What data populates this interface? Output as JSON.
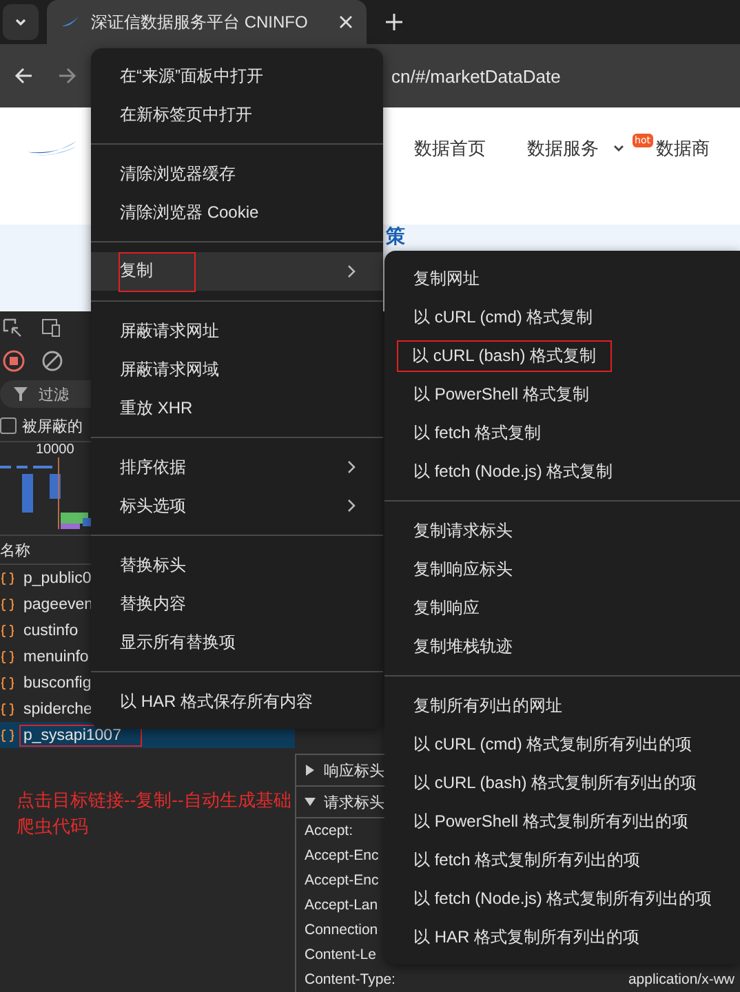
{
  "browser": {
    "tabs": [
      {
        "title": "深证信数据服务平台 CNINFO",
        "selected": true
      }
    ],
    "address": "cn/#/marketDataDate"
  },
  "site": {
    "nav": [
      {
        "label": "数据首页",
        "dropdown": false,
        "hot": false
      },
      {
        "label": "数据服务",
        "dropdown": true,
        "hot": false
      },
      {
        "label": "数据商",
        "dropdown": false,
        "hot": true
      }
    ],
    "hot_badge": "hot",
    "banner_text": "策"
  },
  "devtools": {
    "filter_placeholder": "过滤",
    "blocked_checkbox": {
      "label": "被屏蔽的",
      "checked": false
    },
    "timeline_label": "10000",
    "column": "名称",
    "requests": [
      {
        "name": "p_public0",
        "selected": false,
        "annotated": false
      },
      {
        "name": "pageeven",
        "selected": false,
        "annotated": false
      },
      {
        "name": "custinfo",
        "selected": false,
        "annotated": false
      },
      {
        "name": "menuinfo",
        "selected": false,
        "annotated": false
      },
      {
        "name": "busconfig",
        "selected": false,
        "annotated": false
      },
      {
        "name": "spiderche",
        "selected": false,
        "annotated": false
      },
      {
        "name": "p_sysapi1007",
        "selected": true,
        "annotated": true
      }
    ],
    "detail_sections": [
      {
        "label": "响应标头",
        "expanded": false
      },
      {
        "label": "请求标头",
        "expanded": true
      }
    ],
    "headers": [
      {
        "name": "Accept:"
      },
      {
        "name": "Accept-Enc"
      },
      {
        "name": "Accept-Enc"
      },
      {
        "name": "Accept-Lan"
      },
      {
        "name": "Connection"
      },
      {
        "name": "Content-Le"
      },
      {
        "name": "Content-Type:",
        "value": "application/x-ww"
      }
    ]
  },
  "annotation": "点击目标链接--复制--自动生成基础爬虫代码",
  "context_menu": [
    [
      {
        "label": "在“来源”面板中打开",
        "submenu": false,
        "highlighted": false,
        "annotated": false
      },
      {
        "label": "在新标签页中打开",
        "submenu": false,
        "highlighted": false,
        "annotated": false
      }
    ],
    [
      {
        "label": "清除浏览器缓存",
        "submenu": false,
        "highlighted": false,
        "annotated": false
      },
      {
        "label": "清除浏览器 Cookie",
        "submenu": false,
        "highlighted": false,
        "annotated": false
      }
    ],
    [
      {
        "label": "复制",
        "submenu": true,
        "highlighted": true,
        "annotated": true
      }
    ],
    [
      {
        "label": "屏蔽请求网址",
        "submenu": false,
        "highlighted": false,
        "annotated": false
      },
      {
        "label": "屏蔽请求网域",
        "submenu": false,
        "highlighted": false,
        "annotated": false
      },
      {
        "label": "重放 XHR",
        "submenu": false,
        "highlighted": false,
        "annotated": false
      }
    ],
    [
      {
        "label": "排序依据",
        "submenu": true,
        "highlighted": false,
        "annotated": false
      },
      {
        "label": "标头选项",
        "submenu": true,
        "highlighted": false,
        "annotated": false
      }
    ],
    [
      {
        "label": "替换标头",
        "submenu": false,
        "highlighted": false,
        "annotated": false
      },
      {
        "label": "替换内容",
        "submenu": false,
        "highlighted": false,
        "annotated": false
      },
      {
        "label": "显示所有替换项",
        "submenu": false,
        "highlighted": false,
        "annotated": false
      }
    ],
    [
      {
        "label": "以 HAR 格式保存所有内容",
        "submenu": false,
        "highlighted": false,
        "annotated": false
      }
    ]
  ],
  "copy_submenu": [
    [
      {
        "label": "复制网址",
        "annotated": false
      },
      {
        "label": "以 cURL (cmd) 格式复制",
        "annotated": false
      },
      {
        "label": "以 cURL (bash) 格式复制",
        "annotated": true
      },
      {
        "label": "以 PowerShell 格式复制",
        "annotated": false
      },
      {
        "label": "以 fetch 格式复制",
        "annotated": false
      },
      {
        "label": "以 fetch (Node.js) 格式复制",
        "annotated": false
      }
    ],
    [
      {
        "label": "复制请求标头",
        "annotated": false
      },
      {
        "label": "复制响应标头",
        "annotated": false
      },
      {
        "label": "复制响应",
        "annotated": false
      },
      {
        "label": "复制堆栈轨迹",
        "annotated": false
      }
    ],
    [
      {
        "label": "复制所有列出的网址",
        "annotated": false
      },
      {
        "label": "以 cURL (cmd) 格式复制所有列出的项",
        "annotated": false
      },
      {
        "label": "以 cURL (bash) 格式复制所有列出的项",
        "annotated": false
      },
      {
        "label": "以 PowerShell 格式复制所有列出的项",
        "annotated": false
      },
      {
        "label": "以 fetch 格式复制所有列出的项",
        "annotated": false
      },
      {
        "label": "以 fetch (Node.js) 格式复制所有列出的项",
        "annotated": false
      },
      {
        "label": "以 HAR 格式复制所有列出的项",
        "annotated": false
      }
    ]
  ]
}
